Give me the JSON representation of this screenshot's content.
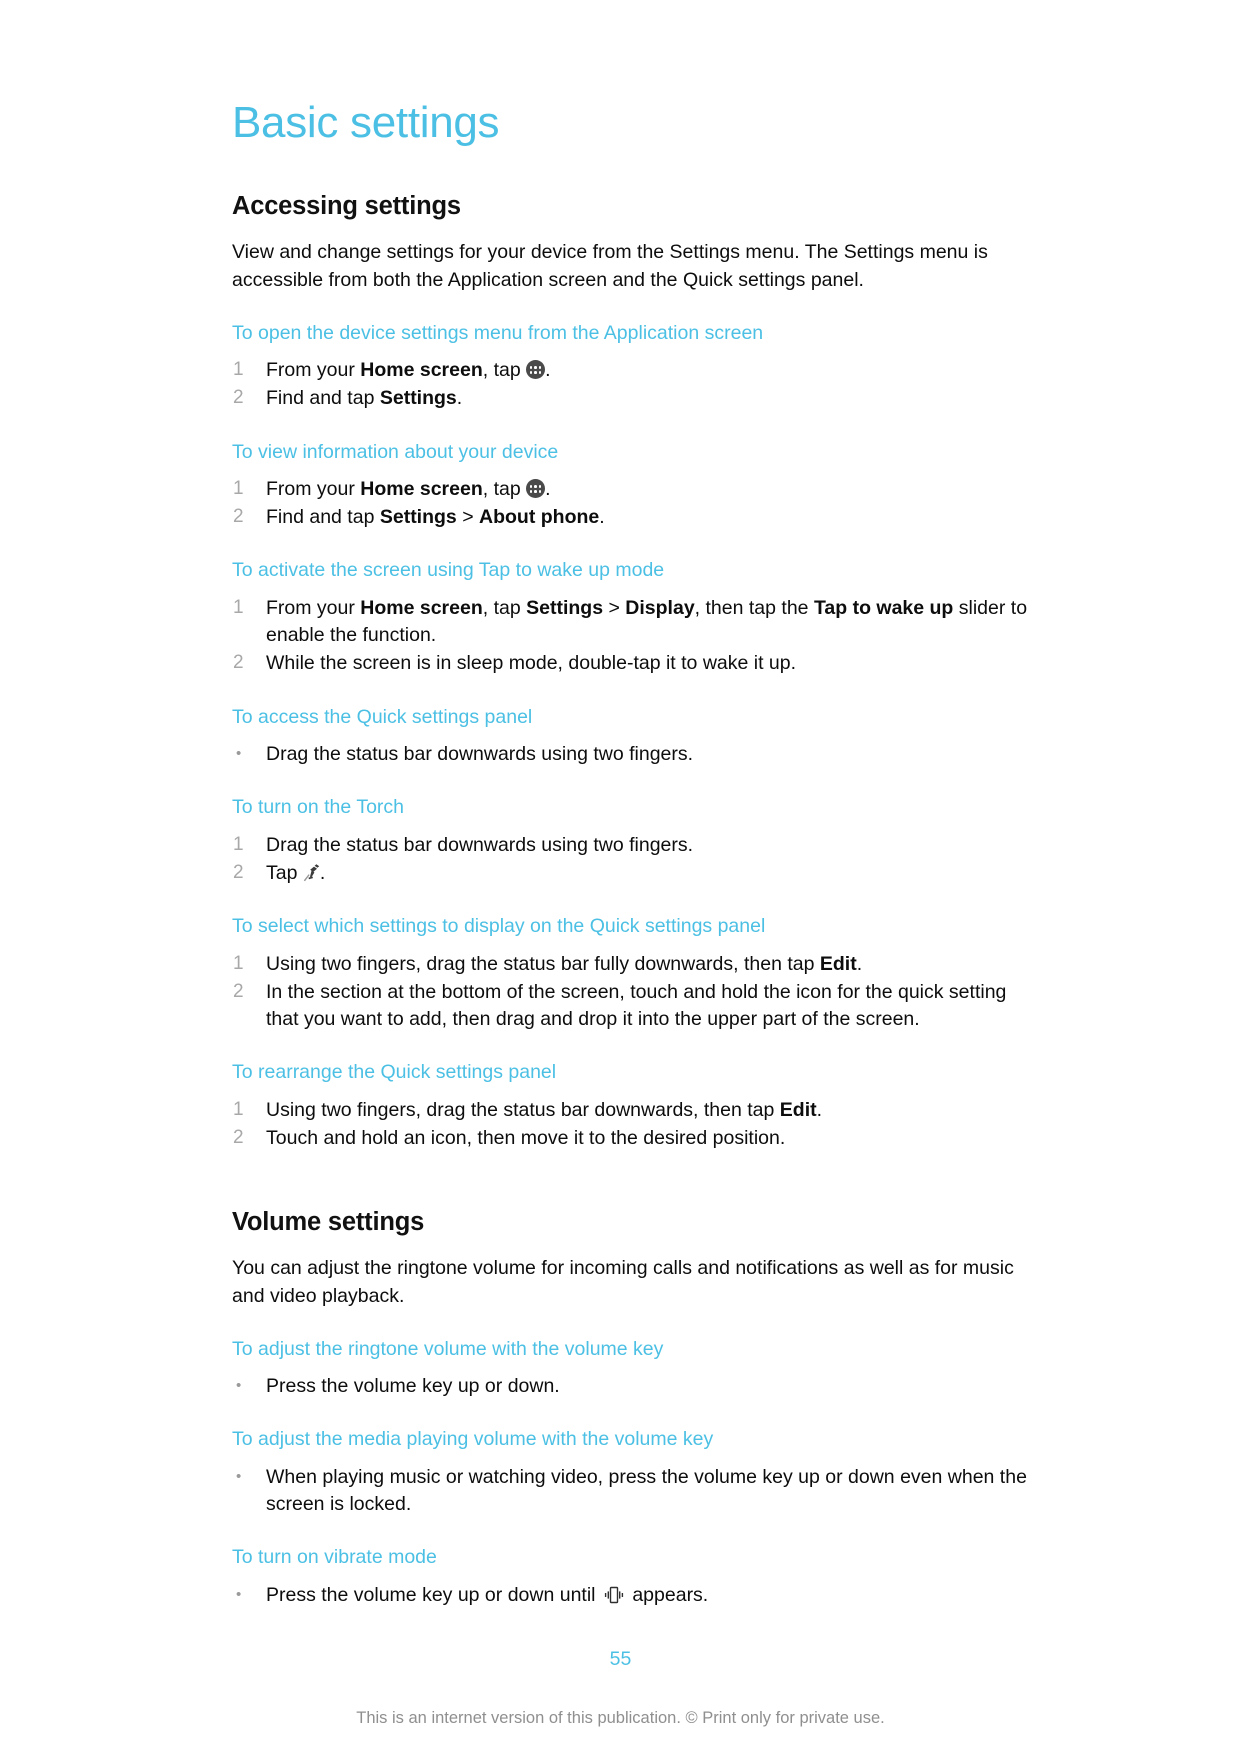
{
  "document": {
    "chapter_title": "Basic settings",
    "page_number": "55",
    "footer_note": "This is an internet version of this publication. © Print only for private use.",
    "accent_color": "#4cc0e4",
    "body_color": "#0d0d0d",
    "marker_color": "#a8a8a8",
    "footer_color": "#8f8f8f"
  },
  "sections": {
    "accessing": {
      "heading": "Accessing settings",
      "intro": "View and change settings for your device from the Settings menu. The Settings menu is accessible from both the Application screen and the Quick settings panel.",
      "tasks": {
        "open_settings": {
          "title": "To open the device settings menu from the Application screen",
          "steps": [
            {
              "marker": "1",
              "text": "From your Home screen, tap ."
            },
            {
              "marker": "2",
              "text": "Find and tap Settings."
            }
          ]
        },
        "view_device_info": {
          "title": "To view information about your device",
          "steps": [
            {
              "marker": "1",
              "text": "From your Home screen, tap ."
            },
            {
              "marker": "2",
              "text": "Find and tap Settings > About phone."
            }
          ]
        },
        "tap_to_wake": {
          "title": "To activate the screen using Tap to wake up mode",
          "steps": [
            {
              "marker": "1",
              "text": "From your Home screen, tap Settings > Display, then tap the Tap to wake up slider to enable the function."
            },
            {
              "marker": "2",
              "text": "While the screen is in sleep mode, double-tap it to wake it up."
            }
          ]
        },
        "quick_settings_access": {
          "title": "To access the Quick settings panel",
          "steps": [
            {
              "marker": "•",
              "text": "Drag the status bar downwards using two fingers."
            }
          ]
        },
        "torch": {
          "title": "To turn on the Torch",
          "steps": [
            {
              "marker": "1",
              "text": "Drag the status bar downwards using two fingers."
            },
            {
              "marker": "2",
              "text": "Tap ."
            }
          ]
        },
        "select_quick_settings": {
          "title": "To select which settings to display on the Quick settings panel",
          "steps": [
            {
              "marker": "1",
              "text": "Using two fingers, drag the status bar fully downwards, then tap Edit."
            },
            {
              "marker": "2",
              "text": "In the section at the bottom of the screen, touch and hold the icon for the quick setting that you want to add, then drag and drop it into the upper part of the screen."
            }
          ]
        },
        "rearrange_quick_settings": {
          "title": "To rearrange the Quick settings panel",
          "steps": [
            {
              "marker": "1",
              "text": "Using two fingers, drag the status bar downwards, then tap Edit."
            },
            {
              "marker": "2",
              "text": "Touch and hold an icon, then move it to the desired position."
            }
          ]
        }
      }
    },
    "volume": {
      "heading": "Volume settings",
      "intro": "You can adjust the ringtone volume for incoming calls and notifications as well as for music and video playback.",
      "tasks": {
        "ringtone_volume": {
          "title": "To adjust the ringtone volume with the volume key",
          "steps": [
            {
              "marker": "•",
              "text": "Press the volume key up or down."
            }
          ]
        },
        "media_volume": {
          "title": "To adjust the media playing volume with the volume key",
          "steps": [
            {
              "marker": "•",
              "text": "When playing music or watching video, press the volume key up or down even when the screen is locked."
            }
          ]
        },
        "vibrate_mode": {
          "title": "To turn on vibrate mode",
          "steps": [
            {
              "marker": "•",
              "text": "Press the volume key up or down until  appears."
            }
          ]
        }
      }
    }
  },
  "inline_text": {
    "from_your": "From your ",
    "home_screen": "Home screen",
    "comma_tap": ", tap ",
    "period": ".",
    "find_and_tap": "Find and tap ",
    "settings": "Settings",
    "about_phone": "About phone",
    "display": "Display",
    "tap_to_wake_up": "Tap to wake up",
    "edit": "Edit",
    "gt": " > ",
    "then_tap_the": ", then tap the ",
    "slider_enable": " slider to enable the function.",
    "step2_wake": "While the screen is in sleep mode, double-tap it to wake it up.",
    "drag_status_bar_two_fingers": "Drag the status bar downwards using two fingers.",
    "tap_word": "Tap ",
    "using_two_fingers_fully": "Using two fingers, drag the status bar fully downwards, then tap ",
    "using_two_fingers": "Using two fingers, drag the status bar downwards, then tap ",
    "select_step2": "In the section at the bottom of the screen, touch and hold the icon for the quick setting that you want to add, then drag and drop it into the upper part of the screen.",
    "rearrange_step2": "Touch and hold an icon, then move it to the desired position.",
    "press_volume_key": "Press the volume key up or down.",
    "media_step": "When playing music or watching video, press the volume key up or down even when the screen is locked.",
    "vibrate_prefix": "Press the volume key up or down until ",
    "vibrate_suffix": " appears."
  },
  "icons": {
    "app_drawer": "app-drawer-icon",
    "torch": "torch-icon",
    "vibrate": "vibrate-icon"
  }
}
